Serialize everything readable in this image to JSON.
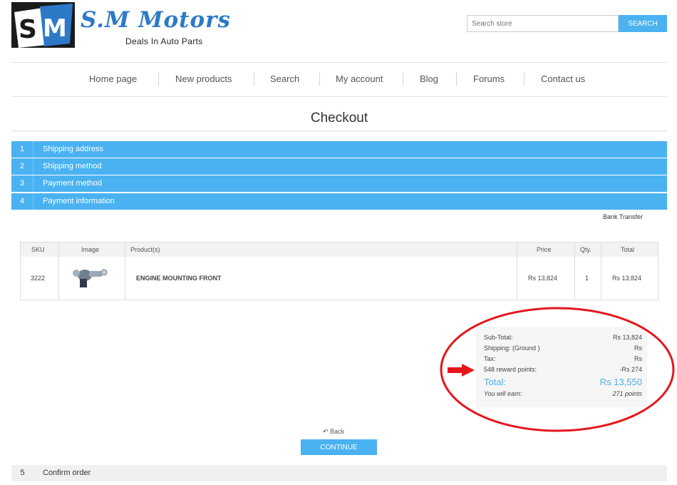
{
  "header": {
    "logo_title": "S.M Motors",
    "logo_tagline": "Deals In Auto Parts",
    "search_placeholder": "Search store",
    "search_button": "SEARCH"
  },
  "nav": [
    "Home page",
    "New products",
    "Search",
    "My account",
    "Blog",
    "Forums",
    "Contact us"
  ],
  "page_title": "Checkout",
  "steps": [
    {
      "num": "1",
      "label": "Shipping address"
    },
    {
      "num": "2",
      "label": "Shipping method"
    },
    {
      "num": "3",
      "label": "Payment method"
    },
    {
      "num": "4",
      "label": "Payment information"
    }
  ],
  "payment_method_value": "Bank Transfer",
  "table": {
    "headers": [
      "SKU",
      "Image",
      "Product(s)",
      "Price",
      "Qty.",
      "Total"
    ],
    "rows": [
      {
        "sku": "3222",
        "product": "ENGINE MOUNTING FRONT",
        "price": "Rs 13,824",
        "qty": "1",
        "total": "Rs 13,824"
      }
    ]
  },
  "totals": {
    "subtotal_label": "Sub-Total:",
    "subtotal_value": "Rs 13,824",
    "shipping_label": "Shipping:",
    "shipping_method": "(Ground )",
    "shipping_value": "Rs",
    "tax_label": "Tax:",
    "tax_value": "Rs",
    "reward_label": "548 reward points:",
    "reward_value": "-Rs 274",
    "total_label": "Total:",
    "total_value": "Rs 13,550",
    "earn_label": "You will earn:",
    "earn_value": "271 points"
  },
  "back_label": "Back",
  "continue_button": "CONTINUE",
  "confirm_step": {
    "num": "5",
    "label": "Confirm order"
  },
  "colors": {
    "accent": "#4ab2f1",
    "annotation": "#e4161c",
    "logo_blue": "#2d79c7"
  }
}
